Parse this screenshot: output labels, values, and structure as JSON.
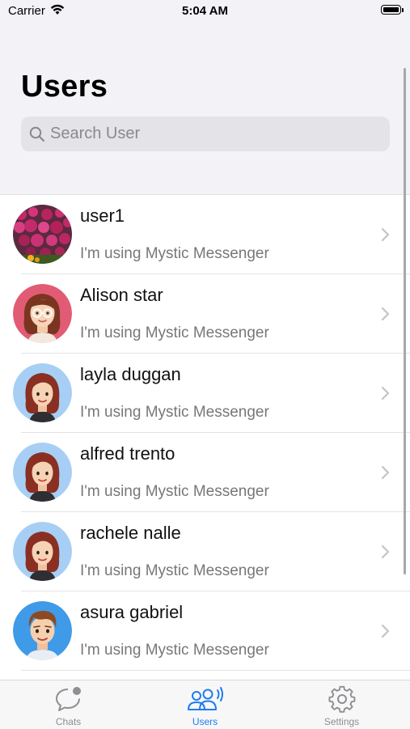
{
  "status_bar": {
    "carrier": "Carrier",
    "time": "5:04 AM"
  },
  "header": {
    "title": "Users"
  },
  "search": {
    "placeholder": "Search User"
  },
  "users": [
    {
      "name": "user1",
      "status": "I'm using Mystic Messenger",
      "avatar": "flowers-photo"
    },
    {
      "name": "Alison star",
      "status": "I'm using Mystic Messenger",
      "avatar": "woman-glasses-avatar"
    },
    {
      "name": "layla duggan",
      "status": "I'm using Mystic Messenger",
      "avatar": "woman-avatar"
    },
    {
      "name": "alfred trento",
      "status": "I'm using Mystic Messenger",
      "avatar": "woman-avatar"
    },
    {
      "name": "rachele nalle",
      "status": "I'm using Mystic Messenger",
      "avatar": "woman-avatar"
    },
    {
      "name": "asura gabriel",
      "status": "I'm using Mystic Messenger",
      "avatar": "man-avatar"
    }
  ],
  "tabs": [
    {
      "label": "Chats",
      "icon": "chat-bubble-icon",
      "active": false
    },
    {
      "label": "Users",
      "icon": "users-icon",
      "active": true
    },
    {
      "label": "Settings",
      "icon": "gear-icon",
      "active": false
    }
  ],
  "colors": {
    "accent": "#1f7cf0",
    "background_header": "#f2f2f7",
    "inactive": "#8e8e93"
  }
}
